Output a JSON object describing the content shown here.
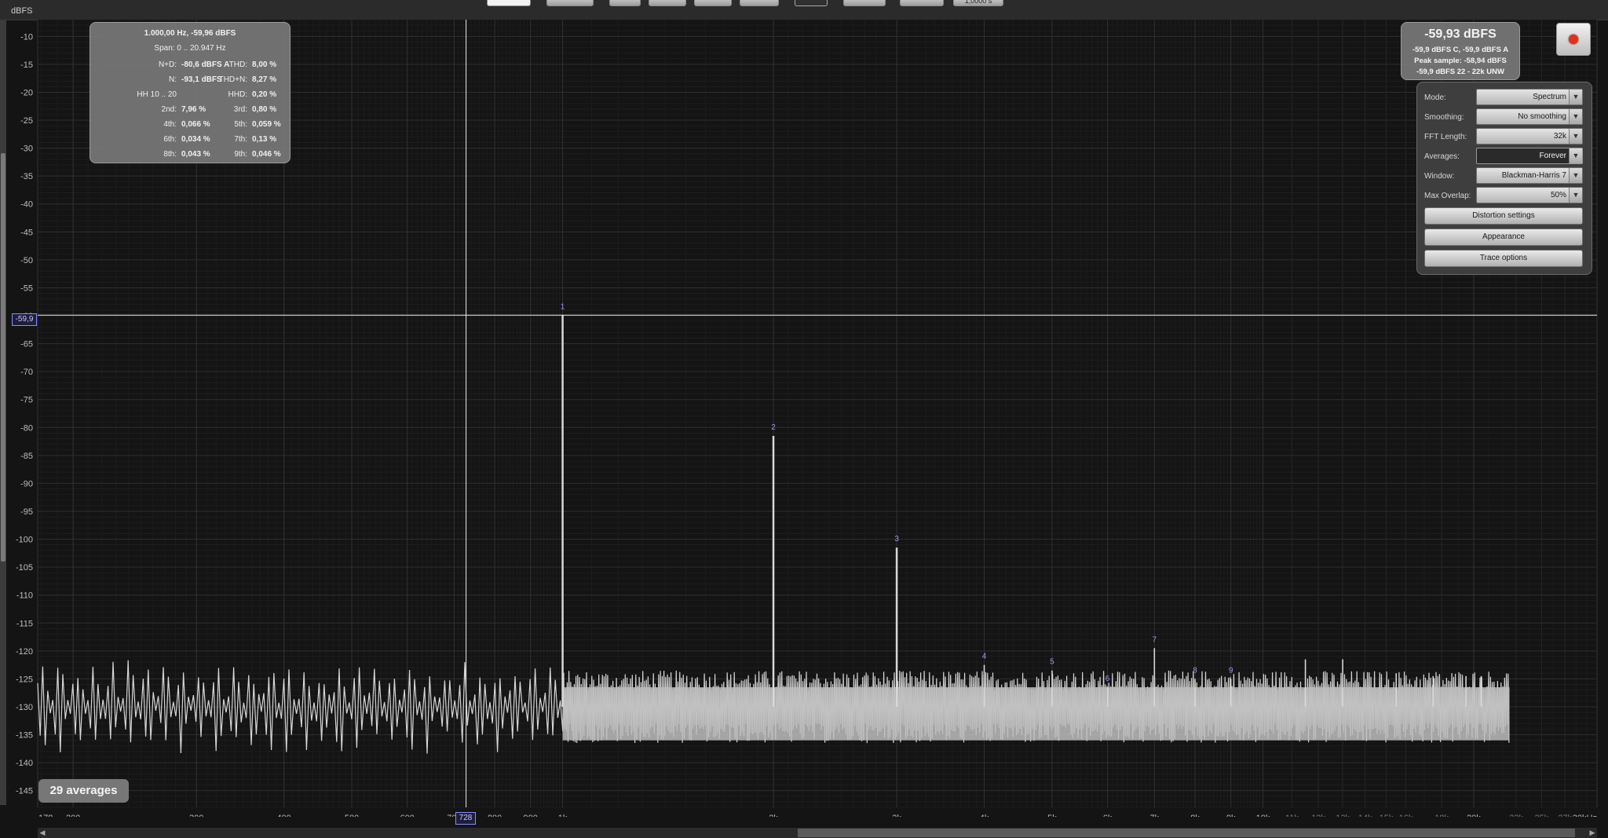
{
  "toolbar": {
    "right_value": "1,0000 s"
  },
  "y_axis": {
    "unit": "dBFS",
    "ticks": [
      "-10",
      "-15",
      "-20",
      "-25",
      "-30",
      "-35",
      "-40",
      "-45",
      "-50",
      "-55",
      "-60",
      "-65",
      "-70",
      "-75",
      "-80",
      "-85",
      "-90",
      "-95",
      "-100",
      "-105",
      "-110",
      "-115",
      "-120",
      "-125",
      "-130",
      "-135",
      "-140",
      "-145"
    ],
    "cursor_value": "-59,9"
  },
  "x_axis": {
    "ticks": [
      {
        "label": "178",
        "dim": false
      },
      {
        "label": "200",
        "dim": false
      },
      {
        "label": "300",
        "dim": false
      },
      {
        "label": "400",
        "dim": false
      },
      {
        "label": "500",
        "dim": false
      },
      {
        "label": "600",
        "dim": false
      },
      {
        "label": "700",
        "dim": false
      },
      {
        "label": "800",
        "dim": false
      },
      {
        "label": "900",
        "dim": false
      },
      {
        "label": "1k",
        "dim": false
      },
      {
        "label": "2k",
        "dim": false
      },
      {
        "label": "3k",
        "dim": false
      },
      {
        "label": "4k",
        "dim": false
      },
      {
        "label": "5k",
        "dim": false
      },
      {
        "label": "6k",
        "dim": false
      },
      {
        "label": "7k",
        "dim": false
      },
      {
        "label": "8k",
        "dim": false
      },
      {
        "label": "9k",
        "dim": false
      },
      {
        "label": "10k",
        "dim": false
      },
      {
        "label": "11k",
        "dim": true
      },
      {
        "label": "12k",
        "dim": true
      },
      {
        "label": "13k",
        "dim": true
      },
      {
        "label": "14k",
        "dim": true
      },
      {
        "label": "15k",
        "dim": true
      },
      {
        "label": "16k",
        "dim": true
      },
      {
        "label": "18k",
        "dim": true
      },
      {
        "label": "20k",
        "dim": false
      },
      {
        "label": "23k",
        "dim": true
      },
      {
        "label": "25k",
        "dim": true
      },
      {
        "label": "27k",
        "dim": true
      },
      {
        "label": "30kHz",
        "dim": false
      }
    ],
    "cursor_value": "728"
  },
  "distortion_panel": {
    "header": "1.000,00 Hz, -59,96 dBFS",
    "span": "Span: 0 .. 20.947 Hz",
    "rows": [
      {
        "l_label": "N+D:",
        "l_value": "-80,6 dBFS A",
        "r_label": "THD:",
        "r_value": "8,00 %"
      },
      {
        "l_label": "N:",
        "l_value": "-93,1 dBFS",
        "r_label": "THD+N:",
        "r_value": "8,27 %"
      },
      {
        "l_label": "HH 10 .. 20",
        "l_value": "",
        "r_label": "HHD:",
        "r_value": "0,20 %"
      },
      {
        "l_label": "2nd:",
        "l_value": "7,96 %",
        "r_label": "3rd:",
        "r_value": "0,80 %"
      },
      {
        "l_label": "4th:",
        "l_value": "0,066 %",
        "r_label": "5th:",
        "r_value": "0,059 %"
      },
      {
        "l_label": "6th:",
        "l_value": "0,034 %",
        "r_label": "7th:",
        "r_value": "0,13 %"
      },
      {
        "l_label": "8th:",
        "l_value": "0,043 %",
        "r_label": "9th:",
        "r_value": "0,046 %"
      }
    ]
  },
  "level_panel": {
    "main": "-59,93 dBFS",
    "line1": "-59,9 dBFS C, -59,9 dBFS A",
    "line2": "Peak sample: -58,94 dBFS",
    "line3": "-59,9 dBFS 22 - 22k UNW"
  },
  "settings": {
    "mode": {
      "label": "Mode:",
      "value": "Spectrum"
    },
    "smoothing": {
      "label": "Smoothing:",
      "value": "No smoothing"
    },
    "fft_length": {
      "label": "FFT Length:",
      "value": "32k"
    },
    "averages": {
      "label": "Averages:",
      "value": "Forever"
    },
    "window": {
      "label": "Window:",
      "value": "Blackman-Harris 7"
    },
    "max_overlap": {
      "label": "Max Overlap:",
      "value": "50%"
    },
    "buttons": {
      "distortion": "Distortion settings",
      "appearance": "Appearance",
      "trace": "Trace options"
    }
  },
  "averages_badge": "29 averages",
  "chart_data": {
    "type": "line",
    "x_scale": "log",
    "xlim": [
      178,
      30000
    ],
    "ylim": [
      -148,
      -7
    ],
    "xlabel": "",
    "ylabel": "dBFS",
    "noise_floor_db": -130,
    "harmonics": [
      {
        "label": "1",
        "freq": 1000,
        "level": -59.9
      },
      {
        "label": "2",
        "freq": 2000,
        "level": -81.5
      },
      {
        "label": "3",
        "freq": 3000,
        "level": -101.5
      },
      {
        "label": "4",
        "freq": 4000,
        "level": -122.5
      },
      {
        "label": "5",
        "freq": 5000,
        "level": -123.5
      },
      {
        "label": "6",
        "freq": 6000,
        "level": -126.5
      },
      {
        "label": "7",
        "freq": 7000,
        "level": -119.5
      },
      {
        "label": "8",
        "freq": 8000,
        "level": -125
      },
      {
        "label": "9",
        "freq": 9000,
        "level": -125
      }
    ],
    "spurs": [
      {
        "freq": 11500,
        "level": -121.5
      },
      {
        "freq": 13000,
        "level": -121.5
      },
      {
        "freq": 15500,
        "level": -124
      },
      {
        "freq": 17500,
        "level": -124.5
      },
      {
        "freq": 19500,
        "level": -124.5
      },
      {
        "freq": 20500,
        "level": -124.5
      }
    ],
    "cursor": {
      "freq": 728,
      "level": -59.9
    }
  }
}
